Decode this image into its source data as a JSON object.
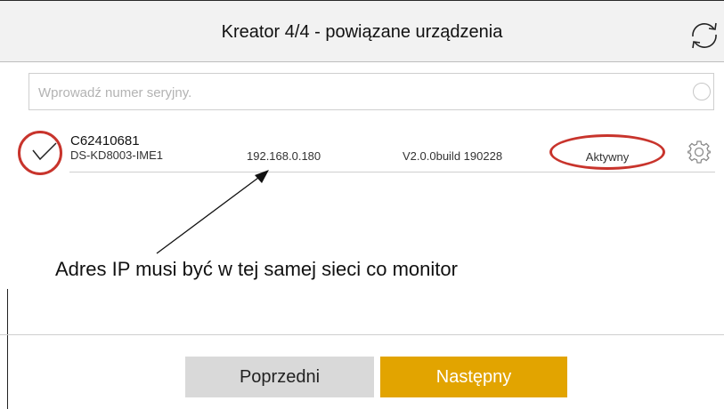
{
  "header": {
    "title": "Kreator 4/4 - powiązane urządzenia",
    "refresh_icon": "refresh-icon"
  },
  "search": {
    "placeholder": "Wprowadź numer seryjny.",
    "value": ""
  },
  "devices": [
    {
      "serial": "C62410681",
      "model": "DS-KD8003-IME1",
      "ip": "192.168.0.180",
      "version": "V2.0.0build 190228",
      "status": "Aktywny",
      "selected": true
    }
  ],
  "annotation": {
    "text": "Adres IP musi być w tej samej sieci co monitor"
  },
  "buttons": {
    "prev_label": "Poprzedni",
    "next_label": "Następny"
  },
  "colors": {
    "accent": "#e2a400",
    "highlight": "#c8342c",
    "header_bg": "#f2f2f2",
    "secondary_button": "#d9d9d9"
  }
}
